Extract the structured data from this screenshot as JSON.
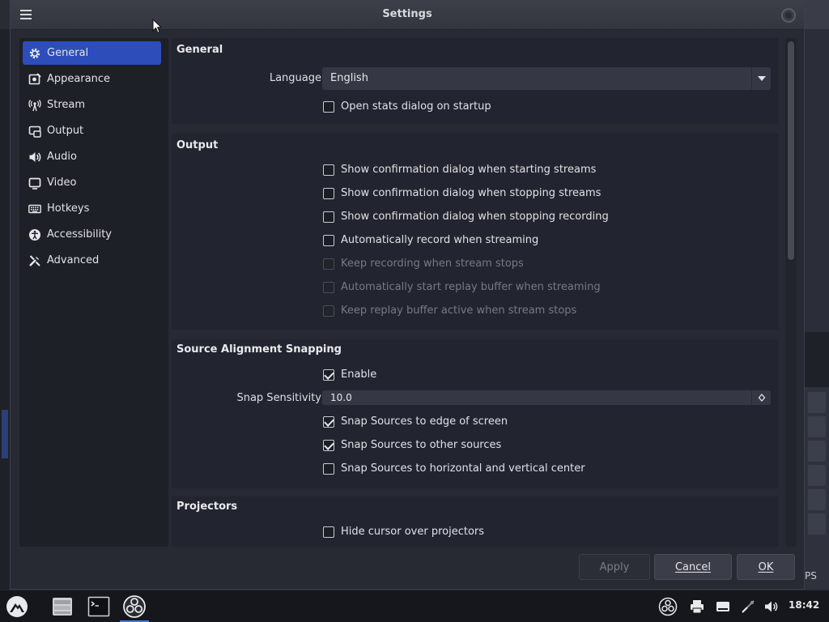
{
  "window": {
    "title": "Settings"
  },
  "sidebar": {
    "items": [
      {
        "label": "General",
        "icon": "gear-icon"
      },
      {
        "label": "Appearance",
        "icon": "appearance-icon"
      },
      {
        "label": "Stream",
        "icon": "antenna-icon"
      },
      {
        "label": "Output",
        "icon": "output-icon"
      },
      {
        "label": "Audio",
        "icon": "speaker-icon"
      },
      {
        "label": "Video",
        "icon": "monitor-icon"
      },
      {
        "label": "Hotkeys",
        "icon": "keyboard-icon"
      },
      {
        "label": "Accessibility",
        "icon": "accessibility-icon"
      },
      {
        "label": "Advanced",
        "icon": "tools-icon"
      }
    ],
    "selected": "General"
  },
  "general": {
    "title": "General",
    "language_label": "Language",
    "language_value": "English",
    "open_stats": "Open stats dialog on startup"
  },
  "output": {
    "title": "Output",
    "options": [
      {
        "label": "Show confirmation dialog when starting streams",
        "checked": false,
        "enabled": true
      },
      {
        "label": "Show confirmation dialog when stopping streams",
        "checked": false,
        "enabled": true
      },
      {
        "label": "Show confirmation dialog when stopping recording",
        "checked": false,
        "enabled": true
      },
      {
        "label": "Automatically record when streaming",
        "checked": false,
        "enabled": true
      },
      {
        "label": "Keep recording when stream stops",
        "checked": false,
        "enabled": false
      },
      {
        "label": "Automatically start replay buffer when streaming",
        "checked": false,
        "enabled": false
      },
      {
        "label": "Keep replay buffer active when stream stops",
        "checked": false,
        "enabled": false
      }
    ]
  },
  "snapping": {
    "title": "Source Alignment Snapping",
    "enable": "Enable",
    "sensitivity_label": "Snap Sensitivity",
    "sensitivity_value": "10.0",
    "options": [
      {
        "label": "Snap Sources to edge of screen",
        "checked": true
      },
      {
        "label": "Snap Sources to other sources",
        "checked": true
      },
      {
        "label": "Snap Sources to horizontal and vertical center",
        "checked": false
      }
    ]
  },
  "projectors": {
    "title": "Projectors",
    "hide_cursor": "Hide cursor over projectors"
  },
  "buttons": {
    "apply": "Apply",
    "cancel": "Cancel",
    "ok": "OK"
  },
  "background": {
    "partial_text": "PS"
  },
  "taskbar": {
    "clock": "18:42",
    "apps": [
      "app-launcher-icon",
      "file-manager-icon",
      "terminal-icon",
      "obs-icon"
    ],
    "tray": [
      "obs-tray-icon",
      "printer-icon",
      "keyboard-layout-icon",
      "network-icon",
      "volume-icon"
    ]
  },
  "colors": {
    "accent": "#2d4dba",
    "dialog_bg": "#272a33",
    "section_bg": "#222430"
  }
}
